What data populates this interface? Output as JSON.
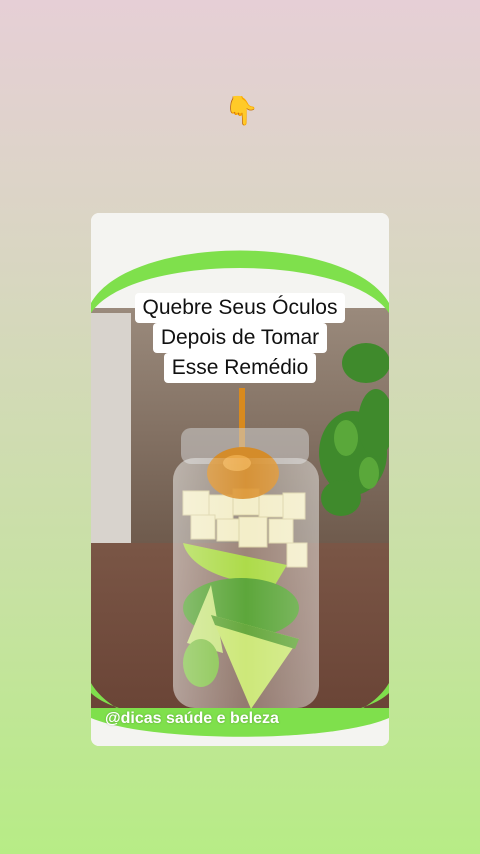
{
  "pointer": {
    "icon": "pointing-down-hand-icon",
    "glyph": "👇"
  },
  "post": {
    "headline_lines": [
      "Quebre Seus Óculos",
      "Depois de Tomar",
      "Esse Remédio"
    ],
    "handle": "@dicas saúde e beleza"
  },
  "colors": {
    "frame_green": "#7fe04c",
    "lime": "#a6d83a",
    "honey": "#d88a1e"
  }
}
